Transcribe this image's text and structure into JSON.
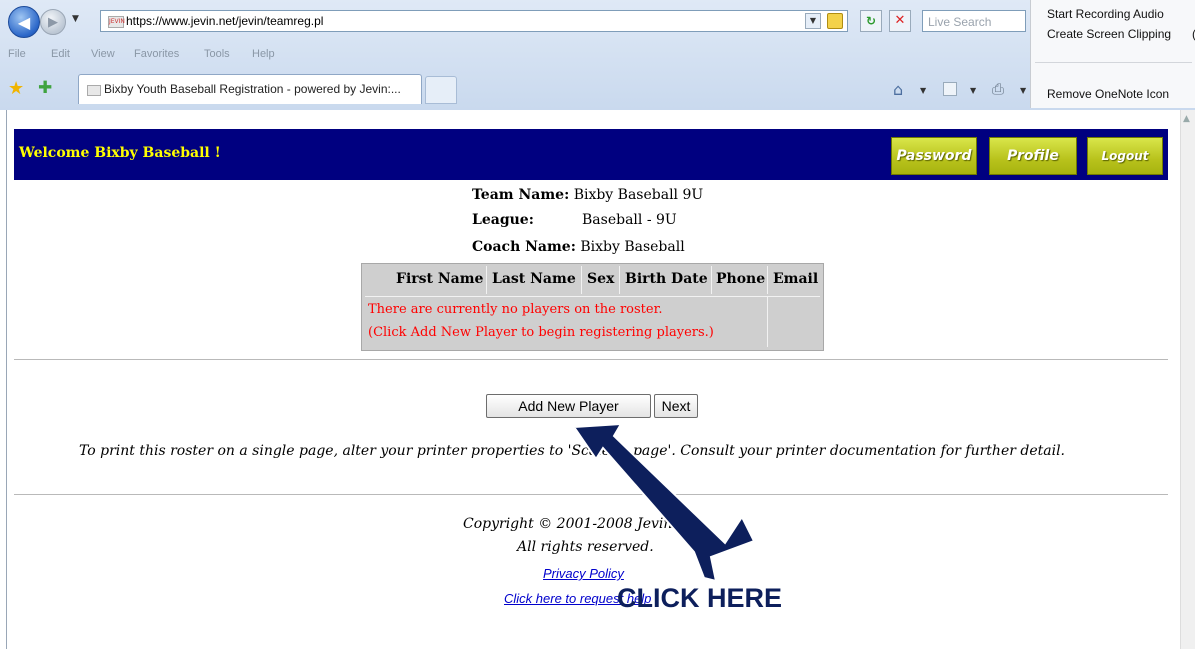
{
  "browser": {
    "url": "https://www.jevin.net/jevin/teamreg.pl",
    "search_placeholder": "Live Search",
    "favicon_text": "JEVIN",
    "menu": [
      "File",
      "Edit",
      "View",
      "Favorites",
      "Tools",
      "Help"
    ],
    "tab_title": "Bixby Youth Baseball Registration - powered by Jevin:...",
    "context_menu": {
      "items": [
        "Start Recording Audio",
        "Create Screen Clipping",
        "Remove OneNote Icon"
      ],
      "overflow_char": "("
    }
  },
  "page": {
    "welcome": "Welcome Bixby Baseball !",
    "header_buttons": [
      "Password",
      "Profile",
      "Logout"
    ],
    "team": {
      "team_name_label": "Team Name:",
      "team_name": "Bixby Baseball 9U",
      "league_label": "League:",
      "league": "Baseball - 9U",
      "coach_label": "Coach Name:",
      "coach": "Bixby Baseball"
    },
    "roster": {
      "columns": [
        "First Name",
        "Last Name",
        "Sex",
        "Birth Date",
        "Phone",
        "Email"
      ],
      "empty_message_1": "There are currently no players on the roster.",
      "empty_message_2": "(Click Add New Player to begin registering players.)"
    },
    "buttons": {
      "add_player": "Add New Player",
      "next": "Next"
    },
    "print_note": "To print this roster on a single page, alter your printer properties to 'Scale to page'. Consult your printer documentation for further detail.",
    "copyright": "Copyright © 2001-2008 Jevin",
    "rights": "All rights reserved.",
    "links": {
      "privacy": "Privacy Policy",
      "help": "Click here to request help"
    }
  },
  "annotation": {
    "text": "CLICK HERE",
    "color": "#0d1f5c"
  },
  "colors": {
    "header_bg": "#000080",
    "welcome_text": "#ffff00",
    "error_text": "#ff0000",
    "link": "#0000cc"
  },
  "icons": [
    "back-arrow-icon",
    "forward-arrow-icon",
    "lock-icon",
    "refresh-icon",
    "stop-icon",
    "favorites-star-icon",
    "add-favorites-icon",
    "home-icon",
    "feeds-icon",
    "print-icon"
  ]
}
